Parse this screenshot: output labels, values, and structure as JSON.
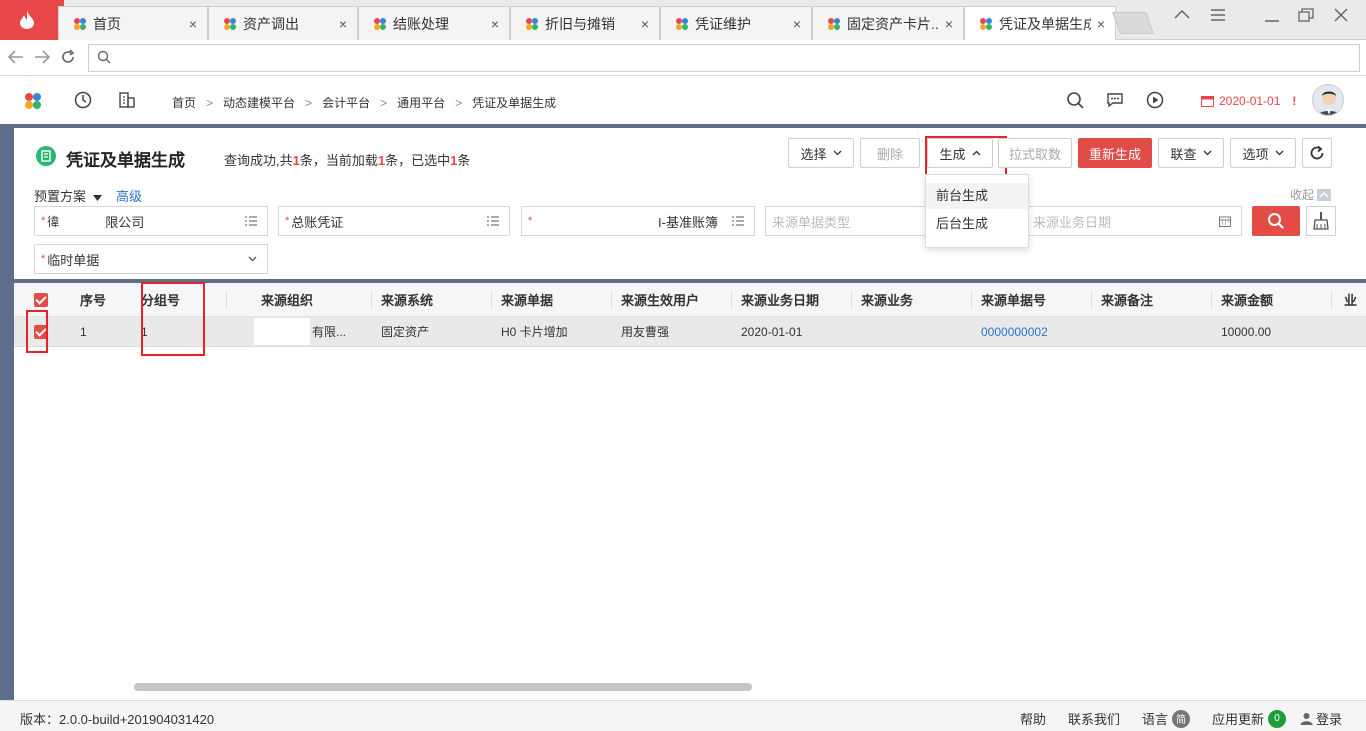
{
  "browser": {
    "tabs": [
      {
        "label": "首页"
      },
      {
        "label": "资产调出"
      },
      {
        "label": "结账处理"
      },
      {
        "label": "折旧与摊销"
      },
      {
        "label": "凭证维护"
      },
      {
        "label": "固定资产卡片..."
      },
      {
        "label": "凭证及单据生成"
      }
    ],
    "close_glyph": "×"
  },
  "header": {
    "breadcrumbs": [
      "首页",
      "动态建模平台",
      "会计平台",
      "通用平台",
      "凭证及单据生成"
    ],
    "crumb_sep": ">",
    "date": "2020-01-01",
    "alert": "!"
  },
  "page": {
    "title": "凭证及单据生成",
    "query_msg": {
      "p1": "查询成功,共",
      "n1": "1",
      "p2": "条，当前加载",
      "n2": "1",
      "p3": "条，已选中",
      "n3": "1",
      "p4": "条"
    }
  },
  "toolbar": {
    "select_label": "选择",
    "delete_label": "删除",
    "generate_label": "生成",
    "pull_label": "拉式取数",
    "regenerate_label": "重新生成",
    "linkquery_label": "联查",
    "options_label": "选项",
    "generate_menu": [
      "前台生成",
      "后台生成"
    ]
  },
  "filters": {
    "preset_label": "预置方案",
    "advanced_label": "高级",
    "collapse_label": "收起",
    "org_prefix": "徫",
    "org_value": "限公司",
    "voucher_type": "总账凭证",
    "accbook": "I-基准账簿",
    "source_bill_type_placeholder": "来源单据类型",
    "source_date_placeholder": "来源业务日期",
    "bill_state": "临时单据"
  },
  "table": {
    "columns": [
      "序号",
      "分组号",
      "来源组织",
      "来源系统",
      "来源单据",
      "来源生效用户",
      "来源业务日期",
      "来源业务",
      "来源单据号",
      "来源备注",
      "来源金额",
      "业"
    ],
    "rows": [
      {
        "seq": "1",
        "group": "1",
        "org": "有限...",
        "system": "固定资产",
        "bill": "H0 卡片增加",
        "user": "用友曹强",
        "date": "2020-01-01",
        "business": "",
        "bill_no": "0000000002",
        "remark": "",
        "amount": "10000.00"
      }
    ]
  },
  "status": {
    "version": "版本：2.0.0-build+201904031420",
    "help": "帮助",
    "contact": "联系我们",
    "language": "语言",
    "language_badge": "简",
    "update": "应用更新",
    "update_count": "0",
    "login": "登录"
  },
  "colors": {
    "brand_red": "#e14c46",
    "link_blue": "#2a73c8",
    "highlight_box": "#e8212b",
    "frame_blue": "#5e6e8a"
  }
}
